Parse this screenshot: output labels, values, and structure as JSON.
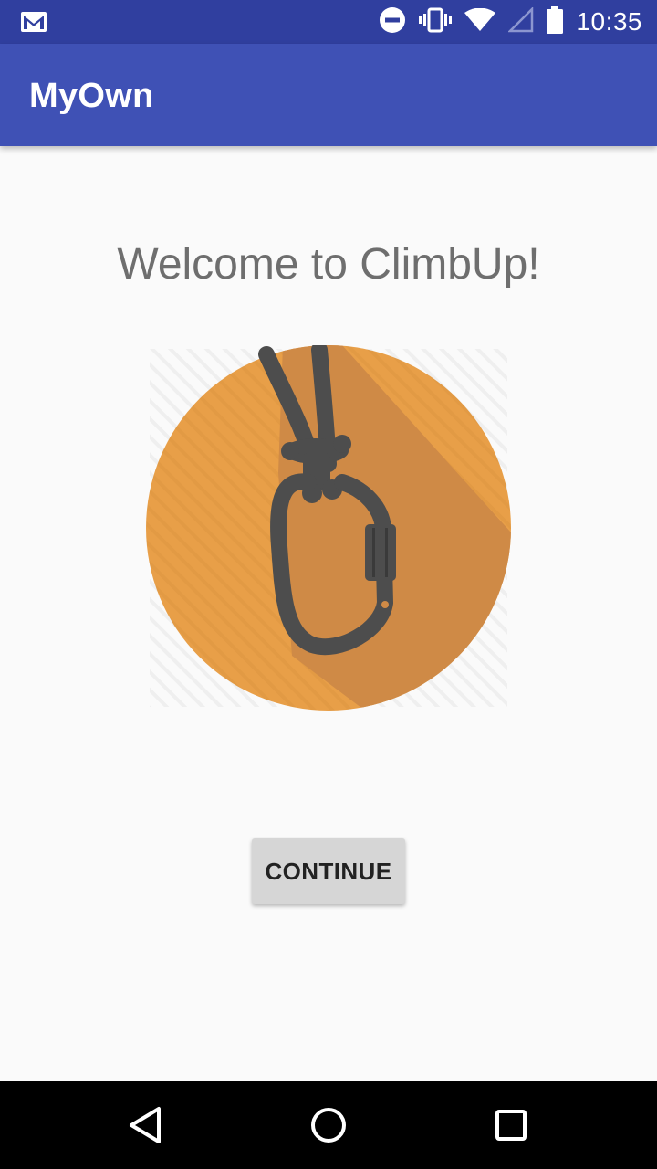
{
  "status_bar": {
    "time": "10:35",
    "icons": [
      "gmail-icon",
      "do-not-disturb-icon",
      "vibrate-icon",
      "wifi-icon",
      "cell-signal-icon",
      "battery-icon"
    ]
  },
  "app_bar": {
    "title": "MyOwn",
    "color": "#3f51b5",
    "status_color": "#303f9f"
  },
  "main": {
    "welcome_text": "Welcome to ClimbUp!",
    "hero_icon": "carabiner-icon",
    "hero_color": "#e89f48",
    "continue_label": "CONTINUE"
  },
  "nav_bar": {
    "buttons": [
      "back-icon",
      "home-icon",
      "recents-icon"
    ]
  }
}
